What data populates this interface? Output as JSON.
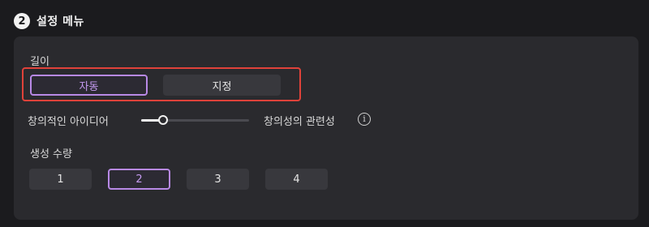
{
  "section": {
    "step_number": "2",
    "title": "설정 메뉴"
  },
  "length": {
    "label": "길이",
    "options": [
      "자동",
      "지정"
    ],
    "selected": "자동"
  },
  "creativity": {
    "left_label": "창의적인 아이디어",
    "right_label": "창의성의 관련성",
    "value": 0.2,
    "info_icon": "info-icon"
  },
  "count": {
    "label": "생성 수량",
    "options": [
      "1",
      "2",
      "3",
      "4"
    ],
    "selected": "2"
  },
  "colors": {
    "accent": "#b889e6",
    "highlight": "#e0423a"
  }
}
